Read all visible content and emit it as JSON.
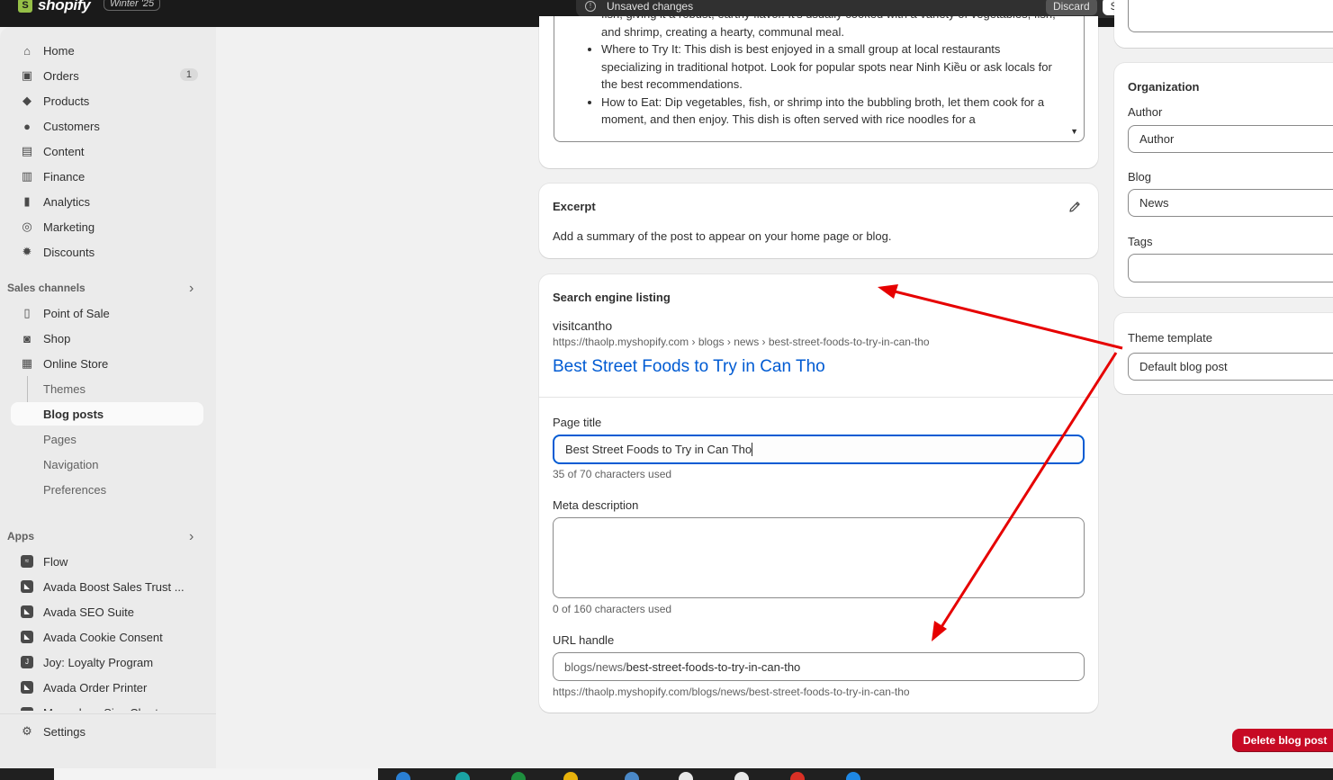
{
  "topbar": {
    "logo_text": "shopify",
    "logo_letter": "S",
    "badge": "Winter '25",
    "unsaved_message": "Unsaved changes",
    "discard_label": "Discard",
    "save_label": "Save"
  },
  "sidebar": {
    "main": [
      {
        "label": "Home",
        "icon": "home-icon",
        "glyph": "⌂"
      },
      {
        "label": "Orders",
        "icon": "orders-icon",
        "glyph": "▣",
        "count": "1"
      },
      {
        "label": "Products",
        "icon": "tag-icon",
        "glyph": "◆"
      },
      {
        "label": "Customers",
        "icon": "person-icon",
        "glyph": "●"
      },
      {
        "label": "Content",
        "icon": "content-icon",
        "glyph": "▤"
      },
      {
        "label": "Finance",
        "icon": "bank-icon",
        "glyph": "▥"
      },
      {
        "label": "Analytics",
        "icon": "bar-chart-icon",
        "glyph": "▮"
      },
      {
        "label": "Marketing",
        "icon": "target-icon",
        "glyph": "◎"
      },
      {
        "label": "Discounts",
        "icon": "discount-icon",
        "glyph": "✹"
      }
    ],
    "sales_channels_label": "Sales channels",
    "channels": [
      {
        "label": "Point of Sale",
        "icon": "pos-icon",
        "glyph": "▯"
      },
      {
        "label": "Shop",
        "icon": "shop-icon",
        "glyph": "◙"
      },
      {
        "label": "Online Store",
        "icon": "store-icon",
        "glyph": "▦"
      }
    ],
    "online_store_sub": [
      {
        "label": "Themes"
      },
      {
        "label": "Blog posts",
        "active": true
      },
      {
        "label": "Pages"
      },
      {
        "label": "Navigation"
      },
      {
        "label": "Preferences"
      }
    ],
    "apps_label": "Apps",
    "apps": [
      {
        "label": "Flow",
        "icon": "flow-icon",
        "glyph": "≈"
      },
      {
        "label": "Avada Boost Sales Trust ...",
        "icon": "avada-icon",
        "glyph": "◣"
      },
      {
        "label": "Avada SEO Suite",
        "icon": "avada-icon",
        "glyph": "◣"
      },
      {
        "label": "Avada Cookie Consent",
        "icon": "avada-icon",
        "glyph": "◣"
      },
      {
        "label": "Joy: Loyalty Program",
        "icon": "joy-icon",
        "glyph": "J"
      },
      {
        "label": "Avada Order Printer",
        "icon": "avada-icon",
        "glyph": "◣"
      },
      {
        "label": "Megaplaza Size Chart",
        "icon": "app-icon",
        "glyph": "▪"
      }
    ],
    "settings_label": "Settings"
  },
  "content": {
    "bullets": [
      {
        "text": "fish, giving it a robust, earthy flavor. It's usually cooked with a variety of vegetables, fish, and shrimp, creating a hearty, communal meal."
      },
      {
        "text": "Where to Try It: This dish is best enjoyed in a small group at local restaurants specializing in traditional hotpot. Look for popular spots near Ninh Kiều or ask locals for the best recommendations."
      },
      {
        "text": "How to Eat: Dip vegetables, fish, or shrimp into the bubbling broth, let them cook for a moment, and then enjoy. This dish is often served with rice noodles for a"
      }
    ],
    "scroll_glyph": "▼"
  },
  "excerpt": {
    "title": "Excerpt",
    "description": "Add a summary of the post to appear on your home page or blog."
  },
  "seo": {
    "title": "Search engine listing",
    "store_name": "visitcantho",
    "breadcrumb_url": "https://thaolp.myshopify.com › blogs › news › best-street-foods-to-try-in-can-tho",
    "preview_title": "Best Street Foods to Try in Can Tho",
    "page_title_label": "Page title",
    "page_title_value": "Best Street Foods to Try in Can Tho",
    "page_title_count": "35 of 70 characters used",
    "meta_label": "Meta description",
    "meta_value": "",
    "meta_count": "0 of 160 characters used",
    "url_label": "URL handle",
    "url_prefix": "blogs/news/",
    "url_handle": "best-street-foods-to-try-in-can-tho",
    "full_url": "https://thaolp.myshopify.com/blogs/news/best-street-foods-to-try-in-can-tho"
  },
  "organization": {
    "title": "Organization",
    "author_label": "Author",
    "author_value": "Author",
    "blog_label": "Blog",
    "blog_value": "News",
    "tags_label": "Tags",
    "tags_value": ""
  },
  "theme": {
    "label": "Theme template",
    "value": "Default blog post"
  },
  "delete_label": "Delete blog post",
  "colors": {
    "link": "#005bd3",
    "danger": "#c70a24",
    "annotation": "#e60000"
  }
}
